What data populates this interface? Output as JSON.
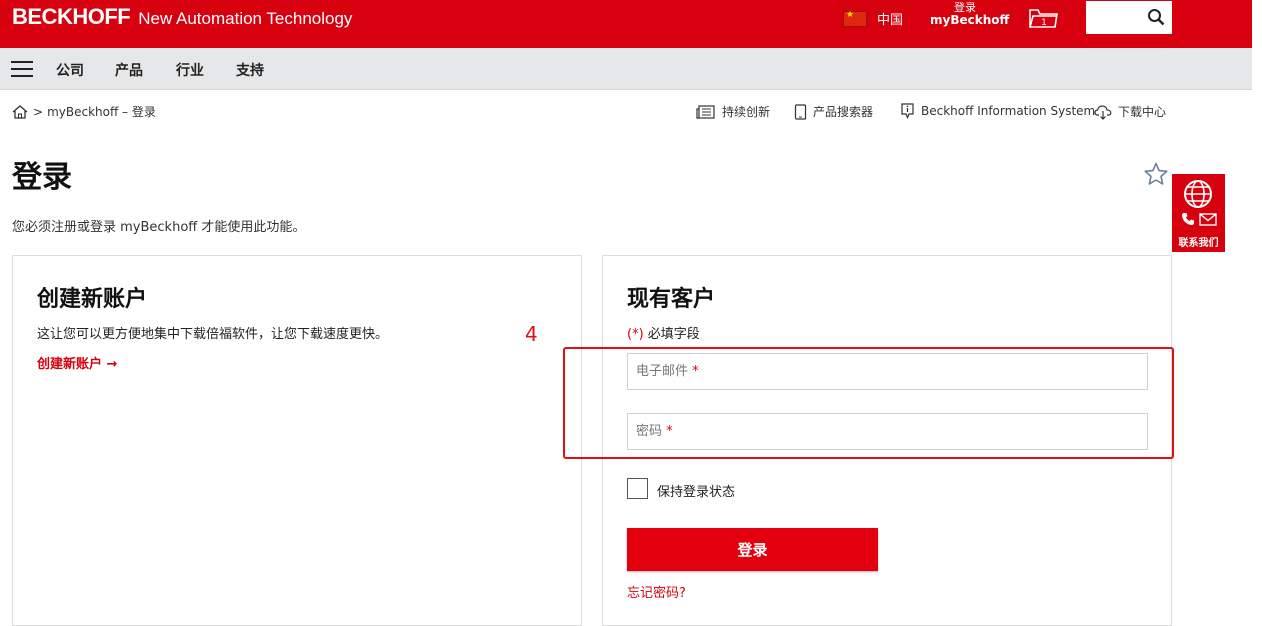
{
  "header": {
    "brand": "BECKHOFF",
    "tagline": "New Automation Technology",
    "country": "中国",
    "login_line1": "登录",
    "login_line2": "myBeckhoff",
    "folder_count": "1",
    "search_placeholder": ""
  },
  "nav": {
    "items": [
      {
        "label": "公司"
      },
      {
        "label": "产品"
      },
      {
        "label": "行业"
      },
      {
        "label": "支持"
      }
    ]
  },
  "breadcrumb": {
    "separator": ">",
    "current": "myBeckhoff – 登录"
  },
  "util_links": [
    {
      "label": "持续创新",
      "icon": "news-icon"
    },
    {
      "label": "产品搜索器",
      "icon": "tablet-icon"
    },
    {
      "label": "Beckhoff Information System",
      "icon": "info-icon"
    },
    {
      "label": "下载中心",
      "icon": "cloud-download-icon"
    }
  ],
  "page": {
    "title": "登录",
    "notice": "您必须注册或登录 myBeckhoff 才能使用此功能。"
  },
  "contact": {
    "label": "联系我们"
  },
  "create_account": {
    "title": "创建新账户",
    "text": "这让您可以更方便地集中下载倍福软件，让您下载速度更快。",
    "link": "创建新账户 →"
  },
  "existing_customer": {
    "title": "现有客户",
    "required_hint_ast": "(*)",
    "required_hint": " 必填字段",
    "email_placeholder": "电子邮件",
    "password_placeholder": "密码",
    "required_mark": "*",
    "remember_label": "保持登录状态",
    "submit_label": "登录",
    "forgot_label": "忘记密码?"
  },
  "annotation": {
    "number": "4"
  },
  "colors": {
    "brand_red": "#d6000e",
    "nav_grey": "#e6e7e8",
    "annotation_red": "#e01010"
  }
}
